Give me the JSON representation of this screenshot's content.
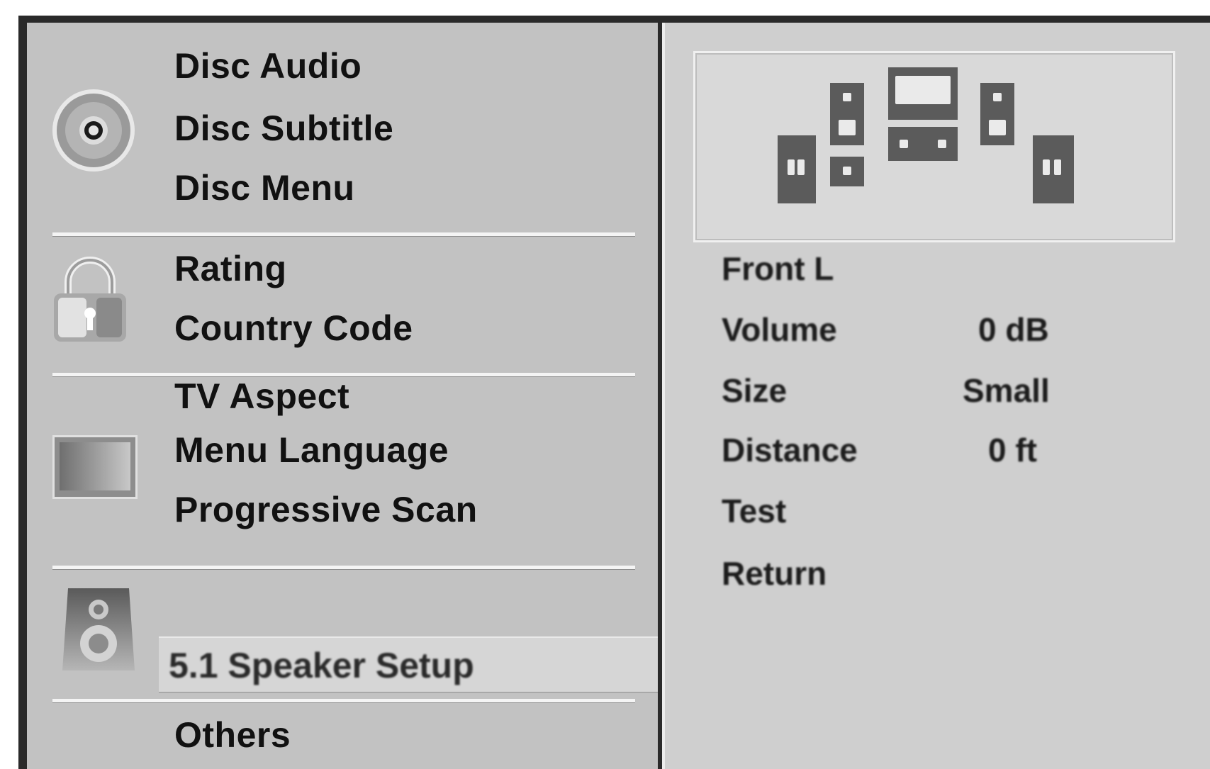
{
  "menu": {
    "disc_group": {
      "items": [
        "Disc Audio",
        "Disc Subtitle",
        "Disc Menu"
      ],
      "icon": "disc-icon"
    },
    "lock_group": {
      "items": [
        "Rating",
        "Country Code"
      ],
      "icon": "lock-icon"
    },
    "display_group": {
      "items": [
        "TV Aspect",
        "Menu Language",
        "Progressive Scan"
      ],
      "icon": "tv-icon"
    },
    "audio_group": {
      "items": [
        "5.1 Speaker Setup"
      ],
      "icon": "speaker-icon",
      "selected": "5.1 Speaker Setup"
    },
    "other_group": {
      "items": [
        "Others"
      ]
    }
  },
  "speaker_setup": {
    "selected_speaker": "Front L",
    "rows": [
      {
        "label": "Volume",
        "value": "0 dB"
      },
      {
        "label": "Size",
        "value": "Small"
      },
      {
        "label": "Distance",
        "value": "0 ft"
      },
      {
        "label": "Test",
        "value": ""
      },
      {
        "label": "Return",
        "value": ""
      }
    ]
  }
}
